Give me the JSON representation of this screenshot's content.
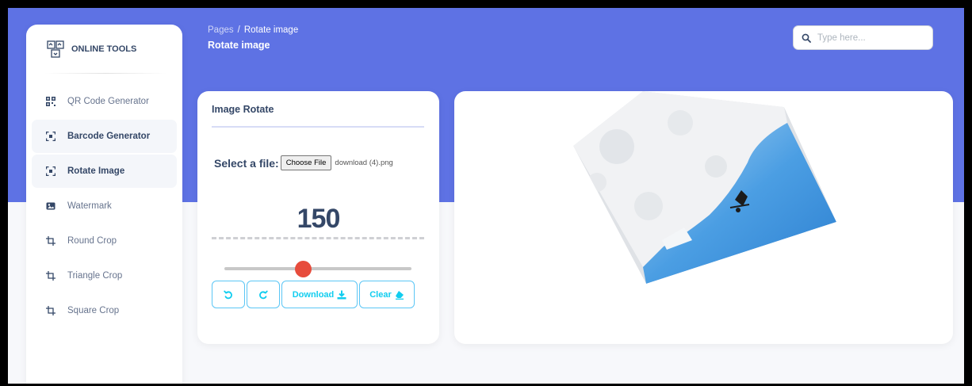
{
  "brand": {
    "name": "ONLINE TOOLS",
    "icon": "tools-grid-icon"
  },
  "sidebar": {
    "items": [
      {
        "label": "QR Code Generator",
        "icon": "qr-code-icon",
        "active": false
      },
      {
        "label": "Barcode Generator",
        "icon": "scan-icon",
        "active": true
      },
      {
        "label": "Rotate Image",
        "icon": "scan-icon",
        "active": true
      },
      {
        "label": "Watermark",
        "icon": "image-icon",
        "active": false
      },
      {
        "label": "Round Crop",
        "icon": "crop-icon",
        "active": false
      },
      {
        "label": "Triangle Crop",
        "icon": "crop-icon",
        "active": false
      },
      {
        "label": "Square Crop",
        "icon": "crop-icon",
        "active": false
      }
    ]
  },
  "header": {
    "breadcrumb": {
      "root": "Pages",
      "separator": "/",
      "current": "Rotate image"
    },
    "title": "Rotate image"
  },
  "search": {
    "placeholder": "Type here..."
  },
  "rotate_card": {
    "title": "Image Rotate",
    "file_label": "Select a file:",
    "choose_button": "Choose File",
    "file_name": "download (4).png",
    "angle": "150",
    "slider_fraction": 0.42,
    "buttons": {
      "rotate_left_icon": "rotate-left-icon",
      "rotate_right_icon": "rotate-right-icon",
      "download": "Download",
      "clear": "Clear"
    }
  },
  "preview": {
    "image": "rotated-snow-photo",
    "rotation_deg": 150
  },
  "colors": {
    "accent": "#5e72e4",
    "button": "#11cdef",
    "slider_thumb": "#e74c3c"
  }
}
